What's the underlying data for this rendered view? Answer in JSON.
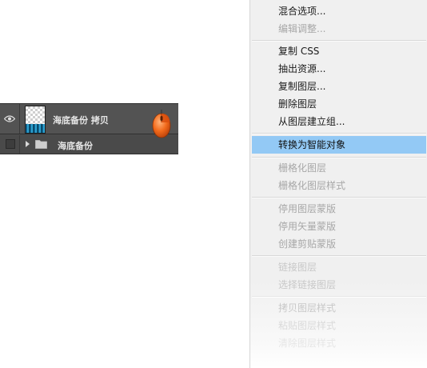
{
  "layers_panel": {
    "layers": [
      {
        "name": "海底备份 拷贝",
        "visible": true,
        "kind": "pixel-layer"
      },
      {
        "name": "海底备份",
        "visible": false,
        "kind": "group-folder",
        "expanded": false
      }
    ]
  },
  "cursor_icon": "mouse-right-click-icon",
  "context_menu": {
    "items": [
      {
        "label": "混合选项...",
        "enabled": true
      },
      {
        "label": "编辑调整...",
        "enabled": false
      },
      {
        "label": "复制 CSS",
        "enabled": true
      },
      {
        "label": "抽出资源...",
        "enabled": true
      },
      {
        "label": "复制图层...",
        "enabled": true
      },
      {
        "label": "删除图层",
        "enabled": true
      },
      {
        "label": "从图层建立组...",
        "enabled": true
      },
      {
        "label": "转换为智能对象",
        "enabled": true,
        "highlighted": true
      },
      {
        "label": "栅格化图层",
        "enabled": false
      },
      {
        "label": "栅格化图层样式",
        "enabled": false
      },
      {
        "label": "停用图层蒙版",
        "enabled": false
      },
      {
        "label": "停用矢量蒙版",
        "enabled": false
      },
      {
        "label": "创建剪贴蒙版",
        "enabled": false
      },
      {
        "label": "链接图层",
        "enabled": false
      },
      {
        "label": "选择链接图层",
        "enabled": false
      },
      {
        "label": "拷贝图层样式",
        "enabled": false
      },
      {
        "label": "粘贴图层样式",
        "enabled": false
      },
      {
        "label": "清除图层样式",
        "enabled": false
      }
    ],
    "highlight_color": "#93c9f5"
  }
}
